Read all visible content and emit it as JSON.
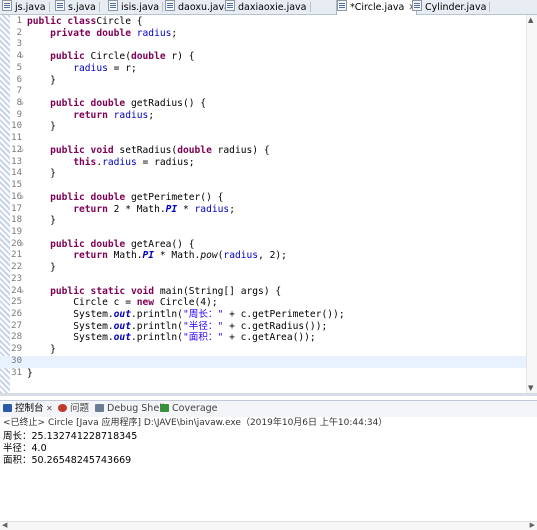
{
  "tabs": [
    {
      "label": "js.java",
      "active": false
    },
    {
      "label": "s.java",
      "active": false
    },
    {
      "label": "isis.java",
      "active": false
    },
    {
      "label": "daoxu.java",
      "active": false
    },
    {
      "label": "daxiaoxie.java",
      "active": false
    },
    {
      "label": "*Circle.java",
      "active": true,
      "close": "✕"
    },
    {
      "label": "Cylinder.java",
      "active": false
    }
  ],
  "editor": {
    "current_line": 30,
    "lines": [
      {
        "n": "1",
        "fold": "",
        "tokens": [
          [
            "kw",
            "public class"
          ],
          [
            "",
            "Circle {"
          ]
        ]
      },
      {
        "n": "2",
        "fold": "",
        "tokens": [
          [
            "",
            "    "
          ],
          [
            "kw",
            "private double"
          ],
          [
            "",
            ""
          ],
          [
            "fld",
            " radius"
          ],
          [
            "",
            ";"
          ]
        ]
      },
      {
        "n": "3",
        "fold": "",
        "tokens": []
      },
      {
        "n": "4",
        "fold": "⊖",
        "tokens": [
          [
            "",
            "    "
          ],
          [
            "kw",
            "public"
          ],
          [
            "",
            " Circle("
          ],
          [
            "kw",
            "double"
          ],
          [
            "",
            " r) {"
          ]
        ]
      },
      {
        "n": "5",
        "fold": "",
        "tokens": [
          [
            "",
            "        "
          ],
          [
            "fld",
            "radius"
          ],
          [
            "",
            " = r;"
          ]
        ]
      },
      {
        "n": "6",
        "fold": "",
        "tokens": [
          [
            "",
            "    }"
          ]
        ]
      },
      {
        "n": "7",
        "fold": "",
        "tokens": []
      },
      {
        "n": "8",
        "fold": "⊖",
        "tokens": [
          [
            "",
            "    "
          ],
          [
            "kw",
            "public double"
          ],
          [
            "",
            " getRadius() {"
          ]
        ]
      },
      {
        "n": "9",
        "fold": "",
        "tokens": [
          [
            "",
            "        "
          ],
          [
            "kw",
            "return"
          ],
          [
            "fld",
            " radius"
          ],
          [
            "",
            ";"
          ]
        ]
      },
      {
        "n": "10",
        "fold": "",
        "tokens": [
          [
            "",
            "    }"
          ]
        ]
      },
      {
        "n": "11",
        "fold": "",
        "tokens": []
      },
      {
        "n": "12",
        "fold": "⊖",
        "tokens": [
          [
            "",
            "    "
          ],
          [
            "kw",
            "public void"
          ],
          [
            "",
            " setRadius("
          ],
          [
            "kw",
            "double"
          ],
          [
            "",
            " radius) {"
          ]
        ]
      },
      {
        "n": "13",
        "fold": "",
        "tokens": [
          [
            "",
            "        "
          ],
          [
            "kw",
            "this"
          ],
          [
            "",
            "."
          ],
          [
            "fld",
            "radius"
          ],
          [
            "",
            " = radius;"
          ]
        ]
      },
      {
        "n": "14",
        "fold": "",
        "tokens": [
          [
            "",
            "    }"
          ]
        ]
      },
      {
        "n": "15",
        "fold": "",
        "tokens": []
      },
      {
        "n": "16",
        "fold": "⊖",
        "tokens": [
          [
            "",
            "    "
          ],
          [
            "kw",
            "public double"
          ],
          [
            "",
            " getPerimeter() {"
          ]
        ]
      },
      {
        "n": "17",
        "fold": "",
        "tokens": [
          [
            "",
            "        "
          ],
          [
            "kw",
            "return"
          ],
          [
            "",
            " 2 * Math."
          ],
          [
            "sfld",
            "PI"
          ],
          [
            "",
            " * "
          ],
          [
            "fld",
            "radius"
          ],
          [
            "",
            ";"
          ]
        ]
      },
      {
        "n": "18",
        "fold": "",
        "tokens": [
          [
            "",
            "    }"
          ]
        ]
      },
      {
        "n": "19",
        "fold": "",
        "tokens": []
      },
      {
        "n": "20",
        "fold": "⊖",
        "tokens": [
          [
            "",
            "    "
          ],
          [
            "kw",
            "public double"
          ],
          [
            "",
            " getArea() {"
          ]
        ]
      },
      {
        "n": "21",
        "fold": "",
        "tokens": [
          [
            "",
            "        "
          ],
          [
            "kw",
            "return"
          ],
          [
            "",
            " Math."
          ],
          [
            "sfld",
            "PI"
          ],
          [
            "",
            " * Math."
          ],
          [
            "it",
            "pow"
          ],
          [
            "",
            "("
          ],
          [
            "fld",
            "radius"
          ],
          [
            "",
            ", 2);"
          ]
        ]
      },
      {
        "n": "22",
        "fold": "",
        "tokens": [
          [
            "",
            "    }"
          ]
        ]
      },
      {
        "n": "23",
        "fold": "",
        "tokens": []
      },
      {
        "n": "24",
        "fold": "⊖",
        "tokens": [
          [
            "",
            "    "
          ],
          [
            "kw",
            "public static void"
          ],
          [
            "",
            " main(String[] args) {"
          ]
        ]
      },
      {
        "n": "25",
        "fold": "",
        "tokens": [
          [
            "",
            "        Circle c = "
          ],
          [
            "kw",
            "new"
          ],
          [
            "",
            " Circle(4);"
          ]
        ]
      },
      {
        "n": "26",
        "fold": "",
        "tokens": [
          [
            "",
            "        System."
          ],
          [
            "sfld",
            "out"
          ],
          [
            "",
            ".println("
          ],
          [
            "str",
            "\"周长：\""
          ],
          [
            "",
            " + c.getPerimeter());"
          ]
        ]
      },
      {
        "n": "27",
        "fold": "",
        "tokens": [
          [
            "",
            "        System."
          ],
          [
            "sfld",
            "out"
          ],
          [
            "",
            ".println("
          ],
          [
            "str",
            "\"半径：\""
          ],
          [
            "",
            " + c.getRadius());"
          ]
        ]
      },
      {
        "n": "28",
        "fold": "",
        "tokens": [
          [
            "",
            "        System."
          ],
          [
            "sfld",
            "out"
          ],
          [
            "",
            ".println("
          ],
          [
            "str",
            "\"面积：\""
          ],
          [
            "",
            " + c.getArea());"
          ]
        ]
      },
      {
        "n": "29",
        "fold": "",
        "tokens": [
          [
            "",
            "    }"
          ]
        ]
      },
      {
        "n": "30",
        "fold": "",
        "tokens": []
      },
      {
        "n": "31",
        "fold": "",
        "tokens": [
          [
            "",
            "}"
          ]
        ]
      }
    ]
  },
  "console": {
    "tabs": [
      {
        "label": "控制台",
        "active": true,
        "close": "✕"
      },
      {
        "label": "问题",
        "active": false
      },
      {
        "label": "Debug Shell",
        "active": false
      },
      {
        "label": "Coverage",
        "active": false
      }
    ],
    "status": "<已终止> Circle [Java 应用程序] D:\\JAVE\\bin\\javaw.exe（2019年10月6日 上午10:44:34）",
    "output": [
      "周长：25.132741228718345",
      "半径：4.0",
      "面积：50.26548245743669"
    ]
  },
  "colors": {
    "keyword": "#7f0055",
    "field": "#0000c0",
    "string": "#2a00ff",
    "current_line": "#e8f2fe"
  },
  "icons": [
    "java-file-icon",
    "console-icon",
    "problems-icon",
    "debug-shell-icon",
    "coverage-icon"
  ]
}
